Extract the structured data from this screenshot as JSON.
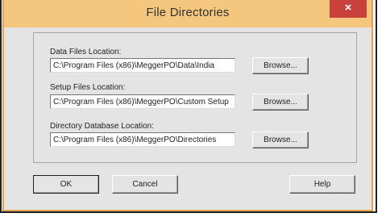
{
  "window": {
    "title": "File Directories",
    "close_label": "×"
  },
  "data_files": {
    "label": "Data Files Location:",
    "value": "C:\\Program Files (x86)\\MeggerPO\\Data\\India",
    "browse_label": "Browse..."
  },
  "setup_files": {
    "label": "Setup Files Location:",
    "value": "C:\\Program Files (x86)\\MeggerPO\\Custom Setup",
    "browse_label": "Browse..."
  },
  "directory_db": {
    "label": "Directory Database Location:",
    "value": "C:\\Program Files (x86)\\MeggerPO\\Directories",
    "browse_label": "Browse..."
  },
  "buttons": {
    "ok": "OK",
    "cancel": "Cancel",
    "help": "Help"
  }
}
